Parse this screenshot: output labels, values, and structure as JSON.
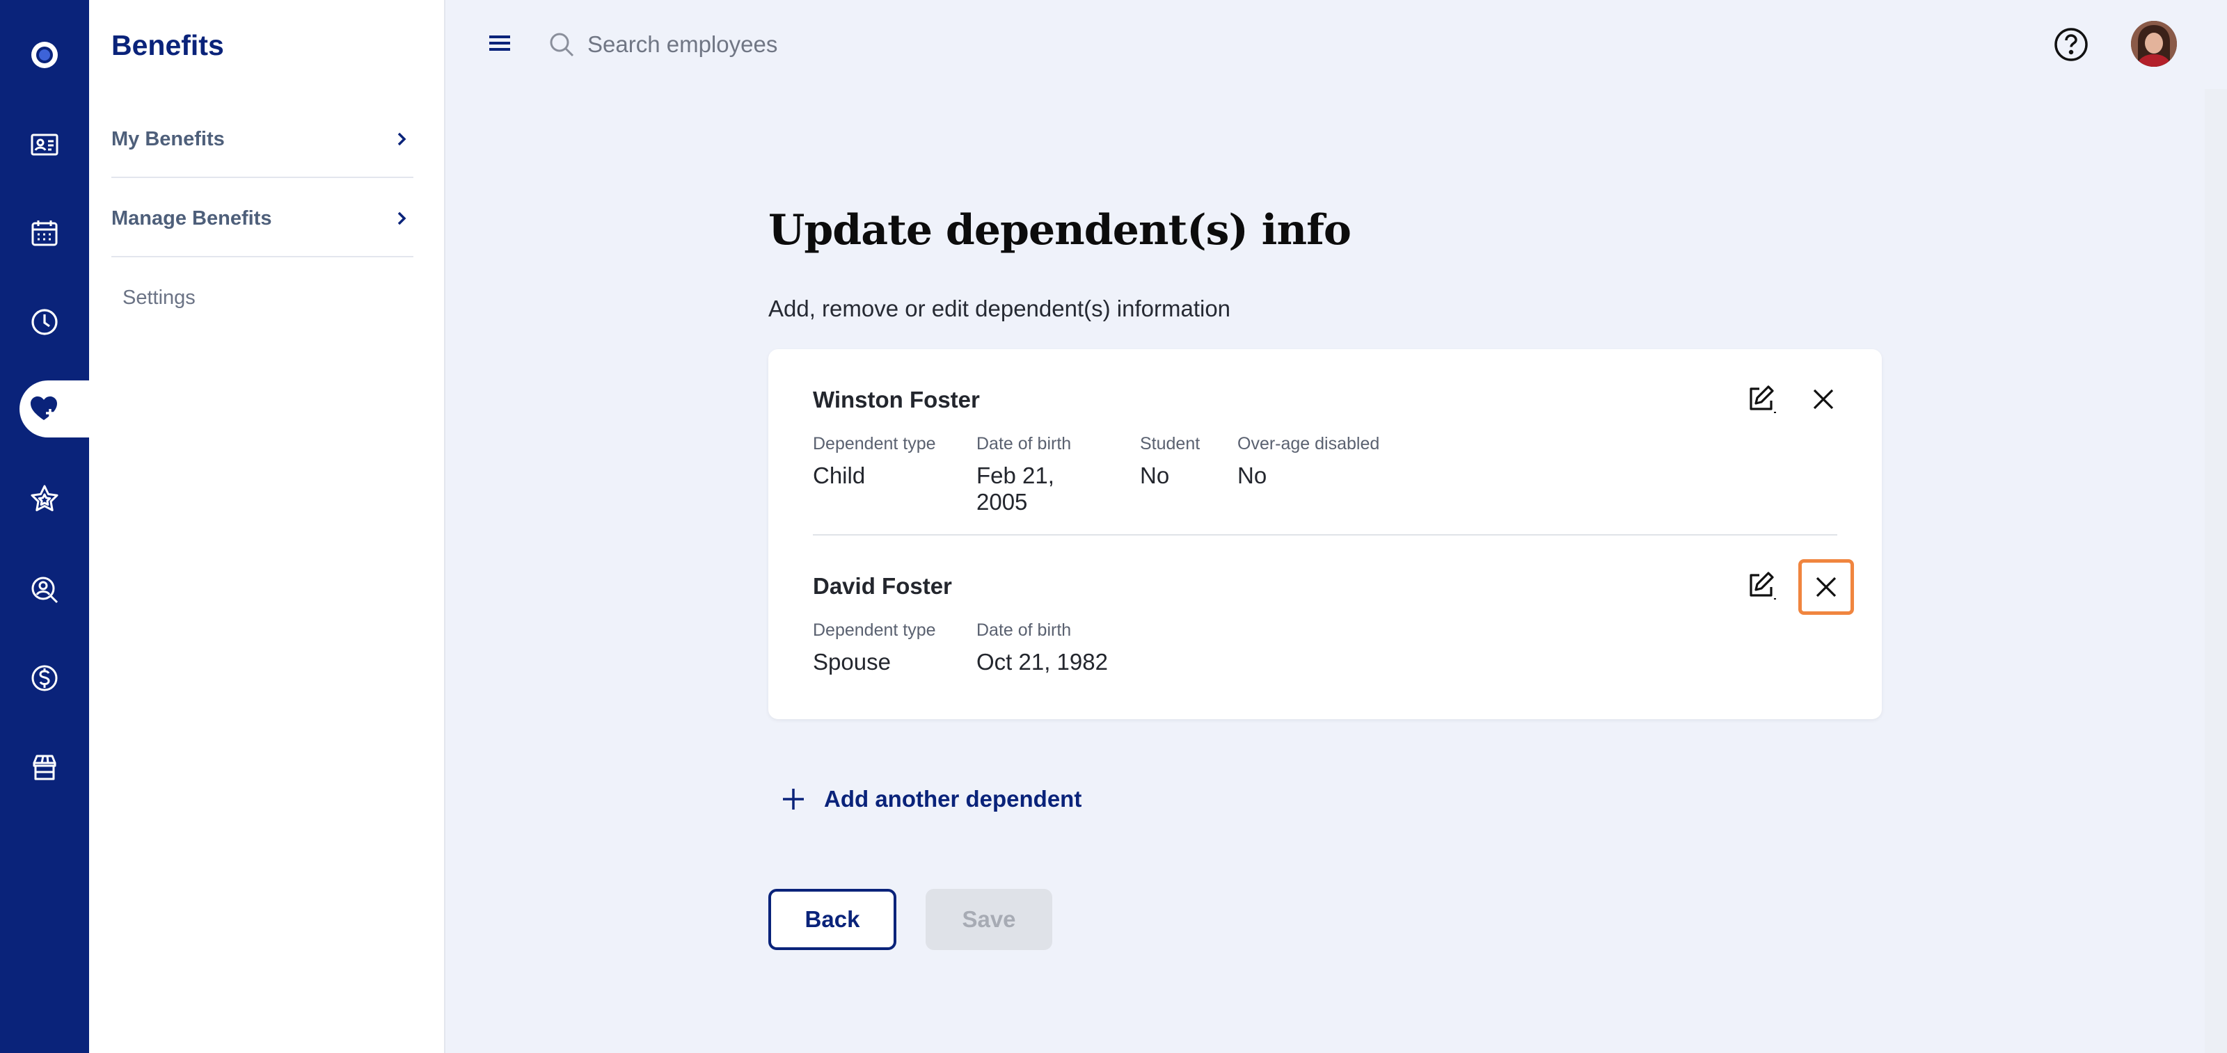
{
  "rail": {
    "items": [
      {
        "icon": "logo-icon"
      },
      {
        "icon": "id-card-icon"
      },
      {
        "icon": "calendar-icon"
      },
      {
        "icon": "clock-icon"
      },
      {
        "icon": "heart-plus-icon",
        "active": true
      },
      {
        "icon": "star-icon"
      },
      {
        "icon": "person-search-icon"
      },
      {
        "icon": "dollar-icon"
      },
      {
        "icon": "store-icon"
      }
    ]
  },
  "subnav": {
    "title": "Benefits",
    "items": [
      {
        "label": "My Benefits"
      },
      {
        "label": "Manage Benefits"
      }
    ],
    "settings_label": "Settings"
  },
  "topbar": {
    "search_placeholder": "Search employees"
  },
  "main": {
    "title": "Update dependent(s) info",
    "subtitle": "Add, remove or edit dependent(s) information",
    "dependents": [
      {
        "name": "Winston Foster",
        "fields": [
          {
            "label": "Dependent type",
            "value": "Child"
          },
          {
            "label": "Date of birth",
            "value": "Feb 21, 2005"
          },
          {
            "label": "Student",
            "value": "No"
          },
          {
            "label": "Over-age disabled",
            "value": "No"
          }
        ]
      },
      {
        "name": "David Foster",
        "fields": [
          {
            "label": "Dependent type",
            "value": "Spouse"
          },
          {
            "label": "Date of birth",
            "value": "Oct 21, 1982"
          }
        ]
      }
    ],
    "add_label": "Add another dependent",
    "back_label": "Back",
    "save_label": "Save"
  },
  "colors": {
    "brand": "#0a237a",
    "background": "#eff2fa",
    "focus": "#f0853f"
  }
}
